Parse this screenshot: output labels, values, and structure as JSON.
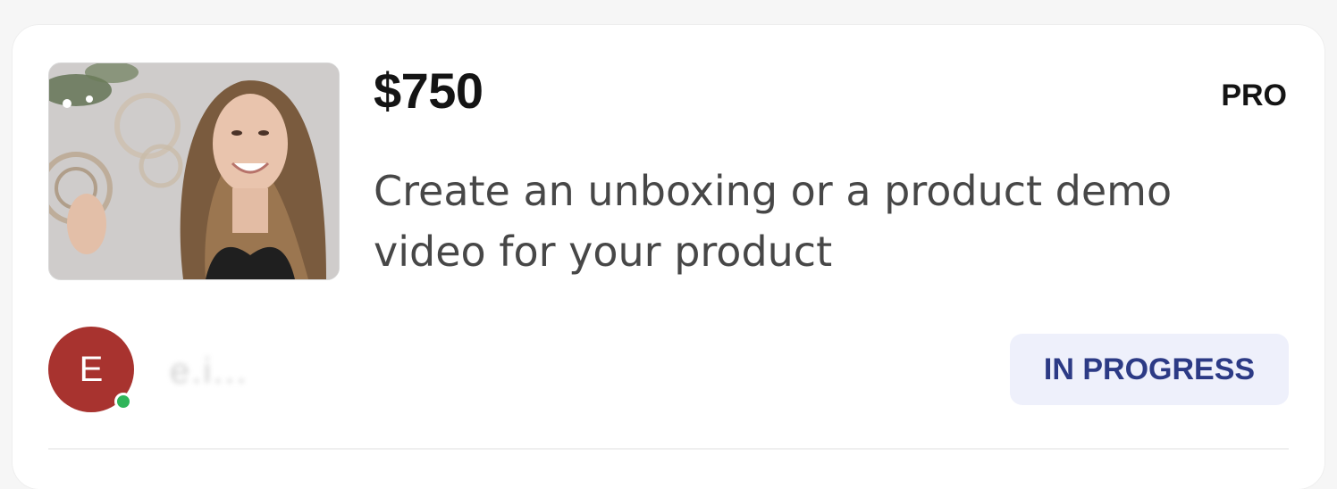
{
  "listing": {
    "price": "$750",
    "tier": "PRO",
    "description": "Create an unboxing or a product demo video for your product",
    "thumbnail": "creator-video-thumbnail"
  },
  "creator": {
    "avatar_letter": "E",
    "username": "e.i...",
    "online": true,
    "avatar_color": "#a8332f"
  },
  "status": {
    "label": "IN PROGRESS",
    "bg_color": "#eef0fb",
    "text_color": "#2c3a85"
  }
}
